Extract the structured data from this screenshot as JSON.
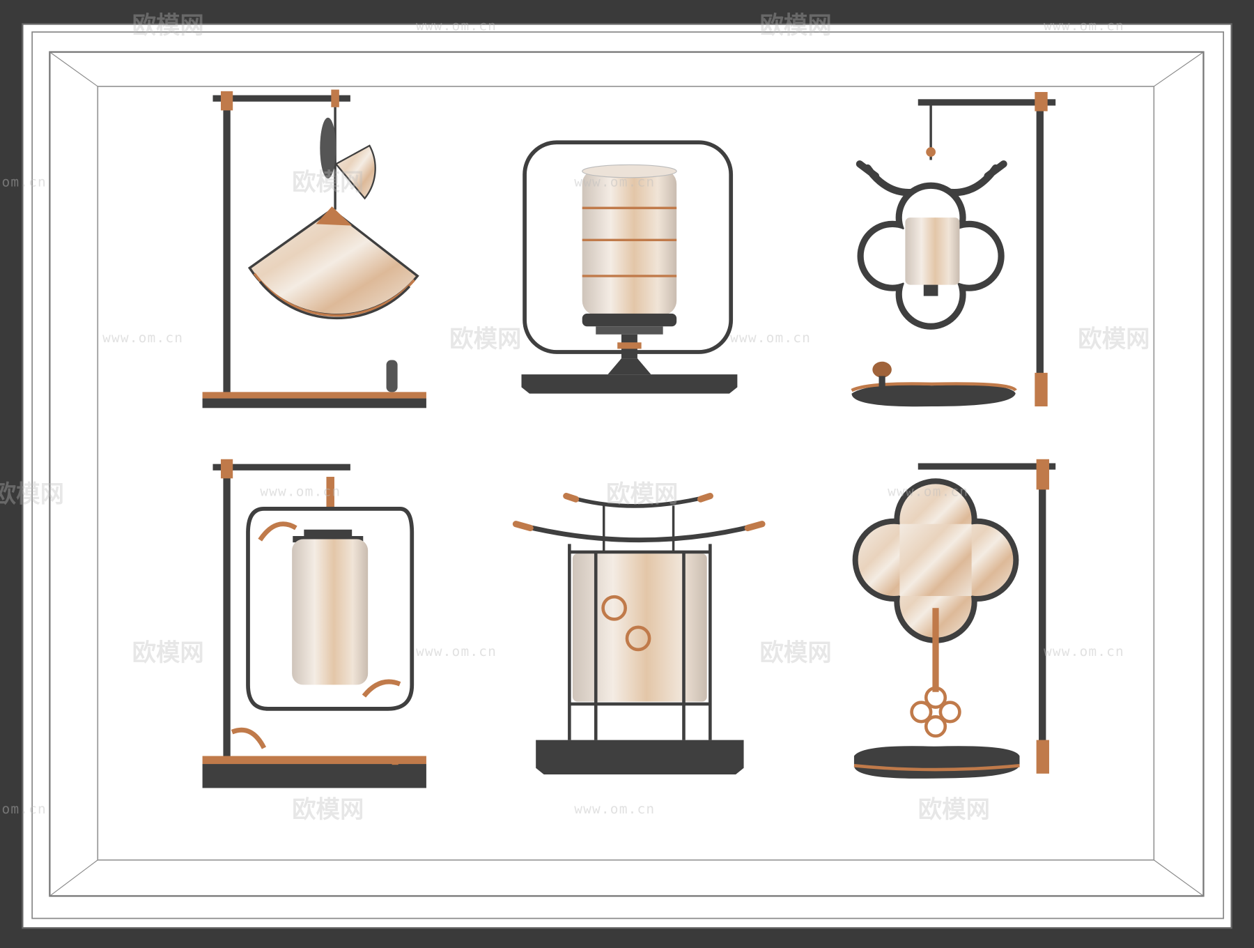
{
  "scene": {
    "subject": "six Chinese-style table lamps in a display frame",
    "watermark": {
      "logo_text": "欧模网",
      "url_text": "www.om.cn"
    }
  },
  "colors": {
    "frame_dark": "#3a3a3a",
    "background": "#ffffff",
    "metal_dark": "#3f3f3f",
    "copper": "#c07a4a",
    "marble_light": "#f1e7dc",
    "marble_vein": "#d8ae88"
  },
  "lamps": [
    {
      "name": "fan-pendant-lamp"
    },
    {
      "name": "round-frame-drum-lamp"
    },
    {
      "name": "antler-quatrefoil-lamp"
    },
    {
      "name": "scroll-frame-cylinder-lamp"
    },
    {
      "name": "pagoda-roof-lantern-lamp"
    },
    {
      "name": "quatrefoil-disk-lamp"
    }
  ]
}
